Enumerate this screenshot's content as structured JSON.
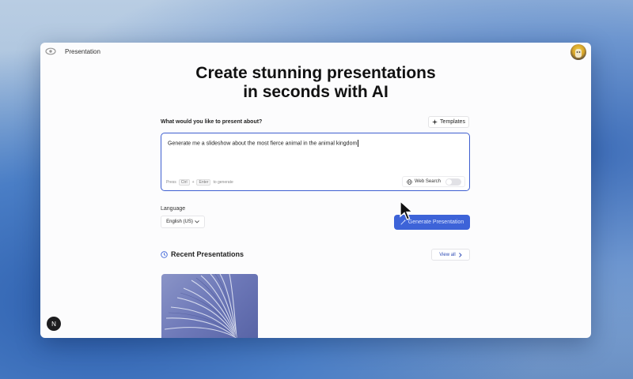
{
  "topbar": {
    "breadcrumb": "Presentation"
  },
  "hero": {
    "line1": "Create stunning presentations",
    "line2": "in seconds with AI"
  },
  "prompt": {
    "label": "What would you like to present about?",
    "templates_label": "Templates",
    "value": "Generate me a slideshow about the most fierce animal in the animal kingdom",
    "hint_press": "Press",
    "hint_key1": "Ctrl",
    "hint_plus": "+",
    "hint_key2": "Enter",
    "hint_to": "to generate",
    "web_search_label": "Web Search",
    "web_search_enabled": false
  },
  "language": {
    "label": "Language",
    "selected": "English (US)"
  },
  "generate_label": "Generate Presentation",
  "recent": {
    "title": "Recent Presentations",
    "view_all_label": "View all"
  },
  "badge": "N",
  "colors": {
    "accent": "#3d63d8",
    "focus_border": "#3f5fd0",
    "badge_bg": "#1d1d1f"
  },
  "icons": [
    "eye-icon",
    "sparkles-icon",
    "globe-icon",
    "chevron-down-icon",
    "wand-icon",
    "clock-icon",
    "chevron-right-icon",
    "cursor-icon"
  ]
}
